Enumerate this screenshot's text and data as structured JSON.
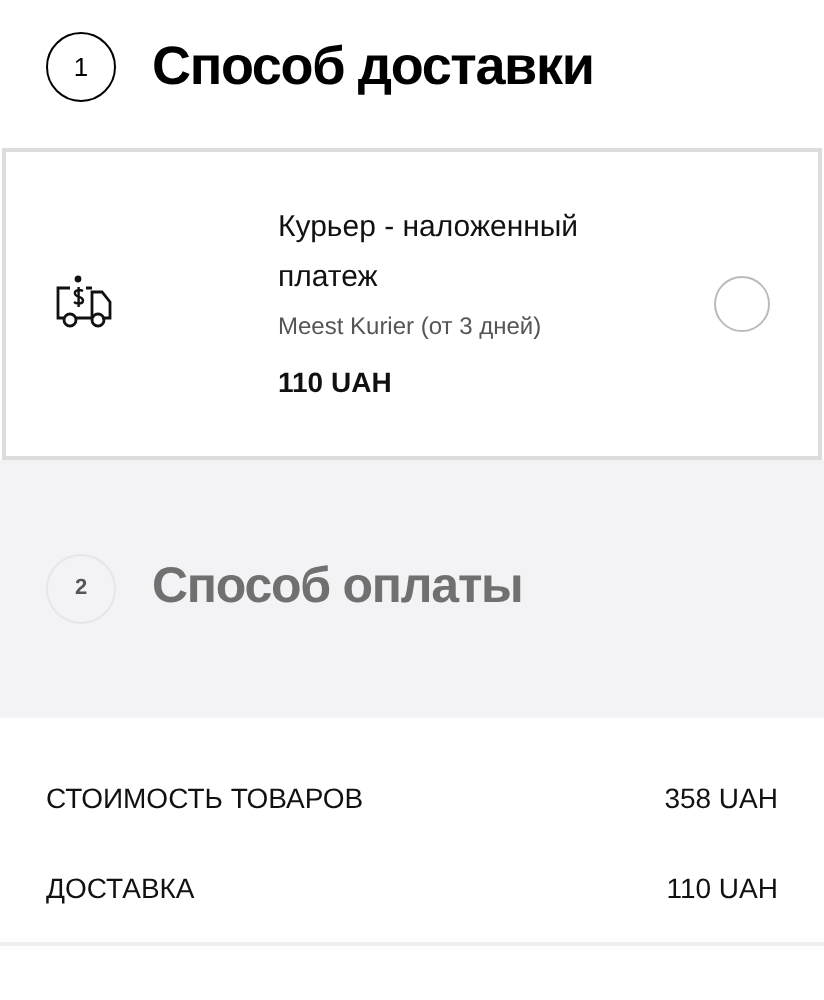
{
  "steps": [
    {
      "number": "1",
      "title": "Способ доставки",
      "disabled": false
    },
    {
      "number": "2",
      "title": "Способ оплаты",
      "disabled": true
    }
  ],
  "delivery_options": [
    {
      "name": "Курьер - наложенный платеж",
      "carrier": "Meest Kurier (от 3 дней)",
      "price": "110 UAH",
      "selected": false
    }
  ],
  "summary": [
    {
      "label": "СТОИМОСТЬ ТОВАРОВ",
      "value": "358 UAH"
    },
    {
      "label": "ДОСТАВКА",
      "value": "110 UAH"
    }
  ]
}
